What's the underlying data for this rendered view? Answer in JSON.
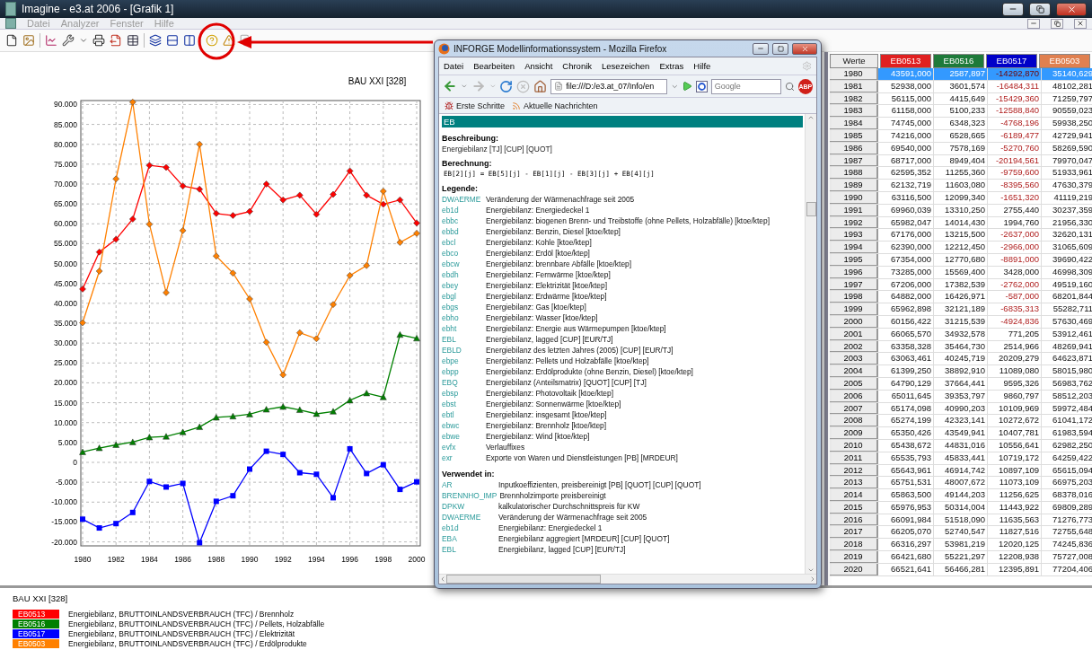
{
  "window": {
    "title": "Imagine - e3.at 2006 - [Grafik 1]"
  },
  "menu": [
    {
      "label": "Datei",
      "disabled": true
    },
    {
      "label": "Analyzer",
      "disabled": true
    },
    {
      "label": "Fenster",
      "disabled": true
    },
    {
      "label": "Hilfe",
      "disabled": true
    }
  ],
  "chart": {
    "title": "BAU XXI [328]",
    "chart_data": {
      "type": "line",
      "grid": true,
      "x": [
        1980,
        1981,
        1982,
        1983,
        1984,
        1985,
        1986,
        1987,
        1988,
        1989,
        1990,
        1991,
        1992,
        1993,
        1994,
        1995,
        1996,
        1997,
        1998,
        1999,
        2000
      ],
      "xlim": [
        1980,
        2000
      ],
      "ylim": [
        -21000,
        91000
      ],
      "xticks": [
        1980,
        1982,
        1984,
        1986,
        1988,
        1990,
        1992,
        1994,
        1996,
        1998,
        2000
      ],
      "yticks": [
        {
          "value": 90000,
          "label": "90.000"
        },
        {
          "value": 85000,
          "label": "85.000"
        },
        {
          "value": 80000,
          "label": "80.000"
        },
        {
          "value": 75000,
          "label": "75.000"
        },
        {
          "value": 70000,
          "label": "70.000"
        },
        {
          "value": 65000,
          "label": "65.000"
        },
        {
          "value": 60000,
          "label": "60.000"
        },
        {
          "value": 55000,
          "label": "55.000"
        },
        {
          "value": 50000,
          "label": "50.000"
        },
        {
          "value": 45000,
          "label": "45.000"
        },
        {
          "value": 40000,
          "label": "40.000"
        },
        {
          "value": 35000,
          "label": "35.000"
        },
        {
          "value": 30000,
          "label": "30.000"
        },
        {
          "value": 25000,
          "label": "25.000"
        },
        {
          "value": 20000,
          "label": "20.000"
        },
        {
          "value": 15000,
          "label": "15.000"
        },
        {
          "value": 10000,
          "label": "10.000"
        },
        {
          "value": 5000,
          "label": "5.000"
        },
        {
          "value": 0,
          "label": "0"
        },
        {
          "value": -5000,
          "label": "-5.000"
        },
        {
          "value": -10000,
          "label": "-10.000"
        },
        {
          "value": -15000,
          "label": "-15.000"
        },
        {
          "value": -20000,
          "label": "-20.000"
        }
      ],
      "series": [
        {
          "name": "EB0513",
          "color": "#ff0000",
          "marker": "diamond",
          "values": [
            43600,
            52900,
            56100,
            61200,
            74700,
            74200,
            69500,
            68700,
            62600,
            62100,
            63100,
            70000,
            66000,
            67200,
            62400,
            67400,
            73300,
            67200,
            64900,
            66000,
            60200
          ]
        },
        {
          "name": "EB0516",
          "color": "#008000",
          "marker": "triangle",
          "values": [
            2600,
            3600,
            4400,
            5100,
            6300,
            6500,
            7600,
            8900,
            11300,
            11600,
            12100,
            13300,
            14000,
            13200,
            12200,
            12800,
            15600,
            17400,
            16400,
            32100,
            31200
          ]
        },
        {
          "name": "EB0517",
          "color": "#0000ff",
          "marker": "square",
          "values": [
            -14300,
            -16500,
            -15400,
            -12600,
            -4800,
            -6200,
            -5300,
            -20200,
            -9800,
            -8400,
            -1700,
            2800,
            2000,
            -2600,
            -3000,
            -8900,
            3400,
            -2800,
            -600,
            -6800,
            -4900
          ]
        },
        {
          "name": "EB0503",
          "color": "#ff8000",
          "marker": "diamond",
          "values": [
            35100,
            48100,
            71300,
            90600,
            59900,
            42700,
            58300,
            80000,
            51900,
            47600,
            41100,
            30200,
            22000,
            32600,
            31100,
            39700,
            47000,
            49500,
            68200,
            55300,
            57600
          ]
        }
      ]
    }
  },
  "table": {
    "header": "Werte",
    "columns": [
      {
        "label": "EB0513",
        "color": "#e02020"
      },
      {
        "label": "EB0516",
        "color": "#1e7a3a"
      },
      {
        "label": "EB0517",
        "color": "#0000c8"
      },
      {
        "label": "EB0503",
        "color": "#e08050"
      }
    ],
    "rows": [
      {
        "year": "1980",
        "selected": true,
        "values": [
          "43591,000",
          "2587,897",
          "-14292,870",
          "35140,629"
        ],
        "negative": [
          false,
          false,
          true,
          false
        ]
      },
      {
        "year": "1981",
        "selected": false,
        "values": [
          "52938,000",
          "3601,574",
          "-16484,311",
          "48102,281"
        ],
        "negative": [
          false,
          false,
          true,
          false
        ]
      },
      {
        "year": "1982",
        "selected": false,
        "values": [
          "56115,000",
          "4415,649",
          "-15429,360",
          "71259,797"
        ],
        "negative": [
          false,
          false,
          true,
          false
        ]
      },
      {
        "year": "1983",
        "selected": false,
        "values": [
          "61158,000",
          "5100,233",
          "-12588,840",
          "90559,023"
        ],
        "negative": [
          false,
          false,
          true,
          false
        ]
      },
      {
        "year": "1984",
        "selected": false,
        "values": [
          "74745,000",
          "6348,323",
          "-4768,196",
          "59938,250"
        ],
        "negative": [
          false,
          false,
          true,
          false
        ]
      },
      {
        "year": "1985",
        "selected": false,
        "values": [
          "74216,000",
          "6528,665",
          "-6189,477",
          "42729,941"
        ],
        "negative": [
          false,
          false,
          true,
          false
        ]
      },
      {
        "year": "1986",
        "selected": false,
        "values": [
          "69540,000",
          "7578,169",
          "-5270,760",
          "58269,590"
        ],
        "negative": [
          false,
          false,
          true,
          false
        ]
      },
      {
        "year": "1987",
        "selected": false,
        "values": [
          "68717,000",
          "8949,404",
          "-20194,561",
          "79970,047"
        ],
        "negative": [
          false,
          false,
          true,
          false
        ]
      },
      {
        "year": "1988",
        "selected": false,
        "values": [
          "62595,352",
          "11255,360",
          "-9759,600",
          "51933,961"
        ],
        "negative": [
          false,
          false,
          true,
          false
        ]
      },
      {
        "year": "1989",
        "selected": false,
        "values": [
          "62132,719",
          "11603,080",
          "-8395,560",
          "47630,379"
        ],
        "negative": [
          false,
          false,
          true,
          false
        ]
      },
      {
        "year": "1990",
        "selected": false,
        "values": [
          "63116,500",
          "12099,340",
          "-1651,320",
          "41119,219"
        ],
        "negative": [
          false,
          false,
          true,
          false
        ]
      },
      {
        "year": "1991",
        "selected": false,
        "values": [
          "69960,039",
          "13310,250",
          "2755,440",
          "30237,359"
        ],
        "negative": [
          false,
          false,
          false,
          false
        ]
      },
      {
        "year": "1992",
        "selected": false,
        "values": [
          "65982,047",
          "14014,430",
          "1994,760",
          "21956,330"
        ],
        "negative": [
          false,
          false,
          false,
          false
        ]
      },
      {
        "year": "1993",
        "selected": false,
        "values": [
          "67176,000",
          "13215,500",
          "-2637,000",
          "32620,131"
        ],
        "negative": [
          false,
          false,
          true,
          false
        ]
      },
      {
        "year": "1994",
        "selected": false,
        "values": [
          "62390,000",
          "12212,450",
          "-2966,000",
          "31065,609"
        ],
        "negative": [
          false,
          false,
          true,
          false
        ]
      },
      {
        "year": "1995",
        "selected": false,
        "values": [
          "67354,000",
          "12770,680",
          "-8891,000",
          "39690,422"
        ],
        "negative": [
          false,
          false,
          true,
          false
        ]
      },
      {
        "year": "1996",
        "selected": false,
        "values": [
          "73285,000",
          "15569,400",
          "3428,000",
          "46998,309"
        ],
        "negative": [
          false,
          false,
          false,
          false
        ]
      },
      {
        "year": "1997",
        "selected": false,
        "values": [
          "67206,000",
          "17382,539",
          "-2762,000",
          "49519,160"
        ],
        "negative": [
          false,
          false,
          true,
          false
        ]
      },
      {
        "year": "1998",
        "selected": false,
        "values": [
          "64882,000",
          "16426,971",
          "-587,000",
          "68201,844"
        ],
        "negative": [
          false,
          false,
          true,
          false
        ]
      },
      {
        "year": "1999",
        "selected": false,
        "values": [
          "65962,898",
          "32121,189",
          "-6835,313",
          "55282,711"
        ],
        "negative": [
          false,
          false,
          true,
          false
        ]
      },
      {
        "year": "2000",
        "selected": false,
        "values": [
          "60156,422",
          "31215,539",
          "-4924,836",
          "57630,469"
        ],
        "negative": [
          false,
          false,
          true,
          false
        ]
      },
      {
        "year": "2001",
        "selected": false,
        "values": [
          "66065,570",
          "34932,578",
          "771,205",
          "53912,461"
        ],
        "negative": [
          false,
          false,
          false,
          false
        ]
      },
      {
        "year": "2002",
        "selected": false,
        "values": [
          "63358,328",
          "35464,730",
          "2514,966",
          "48269,941"
        ],
        "negative": [
          false,
          false,
          false,
          false
        ]
      },
      {
        "year": "2003",
        "selected": false,
        "values": [
          "63063,461",
          "40245,719",
          "20209,279",
          "64623,871"
        ],
        "negative": [
          false,
          false,
          false,
          false
        ]
      },
      {
        "year": "2004",
        "selected": false,
        "values": [
          "61399,250",
          "38892,910",
          "11089,080",
          "58015,980"
        ],
        "negative": [
          false,
          false,
          false,
          false
        ]
      },
      {
        "year": "2005",
        "selected": false,
        "values": [
          "64790,129",
          "37664,441",
          "9595,326",
          "56983,762"
        ],
        "negative": [
          false,
          false,
          false,
          false
        ]
      },
      {
        "year": "2006",
        "selected": false,
        "values": [
          "65011,645",
          "39353,797",
          "9860,797",
          "58512,203"
        ],
        "negative": [
          false,
          false,
          false,
          false
        ]
      },
      {
        "year": "2007",
        "selected": false,
        "values": [
          "65174,098",
          "40990,203",
          "10109,969",
          "59972,484"
        ],
        "negative": [
          false,
          false,
          false,
          false
        ]
      },
      {
        "year": "2008",
        "selected": false,
        "values": [
          "65274,199",
          "42323,141",
          "10272,672",
          "61041,172"
        ],
        "negative": [
          false,
          false,
          false,
          false
        ]
      },
      {
        "year": "2009",
        "selected": false,
        "values": [
          "65350,426",
          "43549,941",
          "10407,781",
          "61983,594"
        ],
        "negative": [
          false,
          false,
          false,
          false
        ]
      },
      {
        "year": "2010",
        "selected": false,
        "values": [
          "65438,672",
          "44831,016",
          "10556,641",
          "62982,250"
        ],
        "negative": [
          false,
          false,
          false,
          false
        ]
      },
      {
        "year": "2011",
        "selected": false,
        "values": [
          "65535,793",
          "45833,441",
          "10719,172",
          "64259,422"
        ],
        "negative": [
          false,
          false,
          false,
          false
        ]
      },
      {
        "year": "2012",
        "selected": false,
        "values": [
          "65643,961",
          "46914,742",
          "10897,109",
          "65615,094"
        ],
        "negative": [
          false,
          false,
          false,
          false
        ]
      },
      {
        "year": "2013",
        "selected": false,
        "values": [
          "65751,531",
          "48007,672",
          "11073,109",
          "66975,203"
        ],
        "negative": [
          false,
          false,
          false,
          false
        ]
      },
      {
        "year": "2014",
        "selected": false,
        "values": [
          "65863,500",
          "49144,203",
          "11256,625",
          "68378,016"
        ],
        "negative": [
          false,
          false,
          false,
          false
        ]
      },
      {
        "year": "2015",
        "selected": false,
        "values": [
          "65976,953",
          "50314,004",
          "11443,922",
          "69809,289"
        ],
        "negative": [
          false,
          false,
          false,
          false
        ]
      },
      {
        "year": "2016",
        "selected": false,
        "values": [
          "66091,984",
          "51518,090",
          "11635,563",
          "71276,773"
        ],
        "negative": [
          false,
          false,
          false,
          false
        ]
      },
      {
        "year": "2017",
        "selected": false,
        "values": [
          "66205,070",
          "52740,547",
          "11827,516",
          "72755,648"
        ],
        "negative": [
          false,
          false,
          false,
          false
        ]
      },
      {
        "year": "2018",
        "selected": false,
        "values": [
          "66316,297",
          "53981,219",
          "12020,125",
          "74245,836"
        ],
        "negative": [
          false,
          false,
          false,
          false
        ]
      },
      {
        "year": "2019",
        "selected": false,
        "values": [
          "66421,680",
          "55221,297",
          "12208,938",
          "75727,008"
        ],
        "negative": [
          false,
          false,
          false,
          false
        ]
      },
      {
        "year": "2020",
        "selected": false,
        "values": [
          "66521,641",
          "56466,281",
          "12395,891",
          "77204,406"
        ],
        "negative": [
          false,
          false,
          false,
          false
        ]
      }
    ]
  },
  "legend": {
    "title": "BAU XXI [328]",
    "items": [
      {
        "label": "Energiebilanz, BRUTTOINLANDSVERBRAUCH (TFC) / Brennholz"
      },
      {
        "label": "Energiebilanz, BRUTTOINLANDSVERBRAUCH (TFC) / Pellets, Holzabfälle"
      },
      {
        "label": "Energiebilanz, BRUTTOINLANDSVERBRAUCH (TFC) / Elektrizität"
      },
      {
        "label": "Energiebilanz, BRUTTOINLANDSVERBRAUCH (TFC) / Erdölprodukte"
      }
    ]
  },
  "browser": {
    "title": "INFORGE Modellinformationssystem - Mozilla Firefox",
    "menu": [
      "Datei",
      "Bearbeiten",
      "Ansicht",
      "Chronik",
      "Lesezeichen",
      "Extras",
      "Hilfe"
    ],
    "url": "file:///D:/e3.at_07/Info/en",
    "search_placeholder": "Google",
    "adblock_label": "ABP",
    "bookmarks": [
      "Erste Schritte",
      "Aktuelle Nachrichten"
    ],
    "heading": "EB",
    "sections": [
      {
        "kind": "text",
        "title": "Beschreibung:",
        "text": "Energiebilanz [TJ] [CUP] [QUOT]"
      },
      {
        "kind": "formula",
        "title": "Berechnung:",
        "text": "EB[2][j] = EB[5][j] - EB[1][j] - EB[3][j] + EB[4][j]"
      },
      {
        "kind": "entries",
        "title": "Legende:",
        "entries": [
          {
            "code": "DWAERME",
            "text": "Veränderung der Wärmenachfrage seit 2005"
          },
          {
            "code": "eb1d",
            "text": "Energiebilanz: Energiedeckel 1"
          },
          {
            "code": "ebbc",
            "text": "Energiebilanz: biogenen Brenn- und Treibstoffe (ohne Pellets, Holzabfälle) [ktoe/ktep]"
          },
          {
            "code": "ebbd",
            "text": "Energiebilanz: Benzin, Diesel [ktoe/ktep]"
          },
          {
            "code": "ebcl",
            "text": "Energiebilanz: Kohle [ktoe/ktep]"
          },
          {
            "code": "ebco",
            "text": "Energiebilanz: Erdöl [ktoe/ktep]"
          },
          {
            "code": "ebcw",
            "text": "Energiebilanz: brennbare Abfälle [ktoe/ktep]"
          },
          {
            "code": "ebdh",
            "text": "Energiebilanz: Fernwärme [ktoe/ktep]"
          },
          {
            "code": "ebey",
            "text": "Energiebilanz: Elektrizität [ktoe/ktep]"
          },
          {
            "code": "ebgl",
            "text": "Energiebilanz: Erdwärme [ktoe/ktep]"
          },
          {
            "code": "ebgs",
            "text": "Energiebilanz: Gas [ktoe/ktep]"
          },
          {
            "code": "ebho",
            "text": "Energiebilanz: Wasser [ktoe/ktep]"
          },
          {
            "code": "ebht",
            "text": "Energiebilanz: Energie aus Wärmepumpen [ktoe/ktep]"
          },
          {
            "code": "EBL",
            "text": "Energiebilanz, lagged [CUP] [EUR/TJ]"
          },
          {
            "code": "EBLD",
            "text": "Energiebilanz des letzten Jahres (2005) [CUP] [EUR/TJ]"
          },
          {
            "code": "ebpe",
            "text": "Energiebilanz: Pellets und Holzabfälle [ktoe/ktep]"
          },
          {
            "code": "ebpp",
            "text": "Energiebilanz: Erdölprodukte (ohne Benzin, Diesel) [ktoe/ktep]"
          },
          {
            "code": "EBQ",
            "text": "Energiebilanz (Anteilsmatrix) [QUOT] [CUP] [TJ]"
          },
          {
            "code": "ebsp",
            "text": "Energiebilanz: Photovoltaik [ktoe/ktep]"
          },
          {
            "code": "ebst",
            "text": "Energiebilanz: Sonnenwärme [ktoe/ktep]"
          },
          {
            "code": "ebtl",
            "text": "Energiebilanz: insgesamt [ktoe/ktep]"
          },
          {
            "code": "ebwc",
            "text": "Energiebilanz: Brennholz [ktoe/ktep]"
          },
          {
            "code": "ebwe",
            "text": "Energiebilanz: Wind [ktoe/ktep]"
          },
          {
            "code": "evfx",
            "text": "Verlauffixes"
          },
          {
            "code": "exr",
            "text": "Exporte von Waren und Dienstleistungen [PB] [MRDEUR]"
          }
        ]
      },
      {
        "kind": "entries",
        "title": "Verwendet in:",
        "entries": [
          {
            "code": "AR",
            "text": "Inputkoeffizienten, preisbereinigt [PB] [QUOT] [CUP] [QUOT]"
          },
          {
            "code": "BRENNHO_IMP",
            "text": "Brennholzimporte preisbereinigt"
          },
          {
            "code": "DPKW",
            "text": "kalkulatorischer Durchschnittspreis für KW"
          },
          {
            "code": "DWAERME",
            "text": "Veränderung der Wärmenachfrage seit 2005"
          },
          {
            "code": "eb1d",
            "text": "Energiebilanz: Energiedeckel 1"
          },
          {
            "code": "EBA",
            "text": "Energiebilanz aggregiert [MRDEUR] [CUP] [QUOT]"
          },
          {
            "code": "EBL",
            "text": "Energiebilanz, lagged [CUP] [EUR/TJ]"
          }
        ]
      }
    ]
  }
}
